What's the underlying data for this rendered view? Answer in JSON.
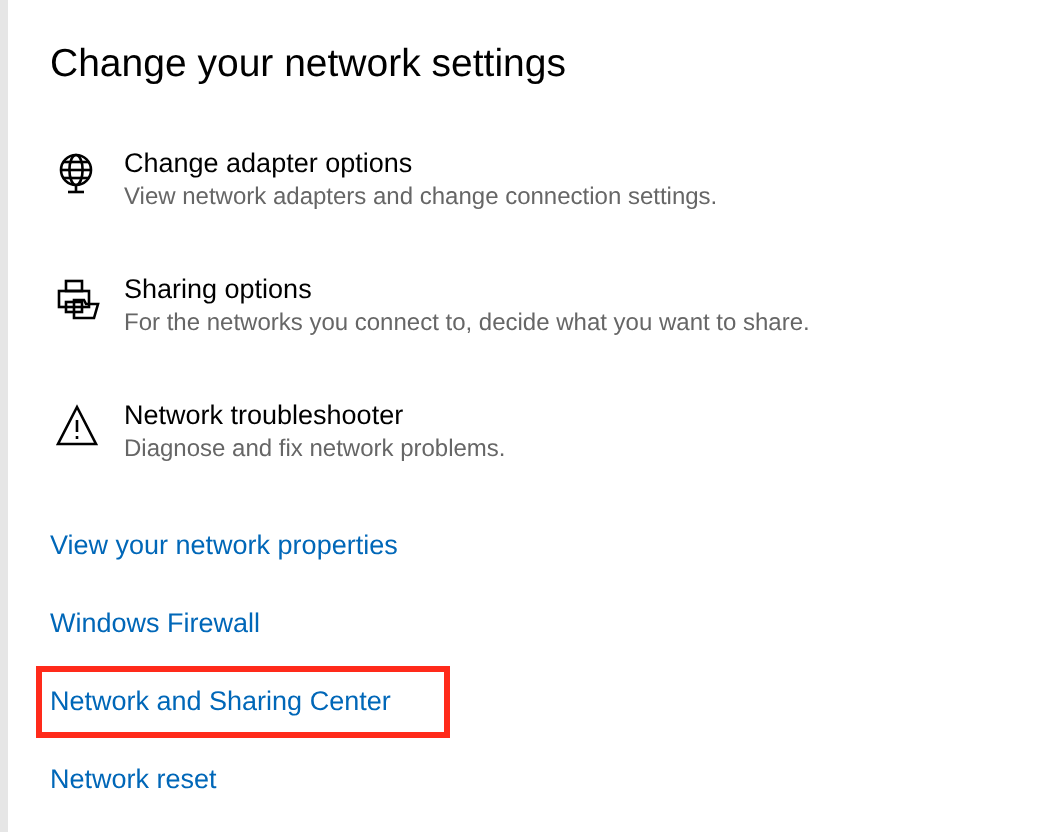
{
  "title": "Change your network settings",
  "options": [
    {
      "title": "Change adapter options",
      "description": "View network adapters and change connection settings."
    },
    {
      "title": "Sharing options",
      "description": "For the networks you connect to, decide what you want to share."
    },
    {
      "title": "Network troubleshooter",
      "description": "Diagnose and fix network problems."
    }
  ],
  "links": [
    {
      "label": "View your network properties",
      "highlighted": false
    },
    {
      "label": "Windows Firewall",
      "highlighted": false
    },
    {
      "label": "Network and Sharing Center",
      "highlighted": true
    },
    {
      "label": "Network reset",
      "highlighted": false
    }
  ]
}
